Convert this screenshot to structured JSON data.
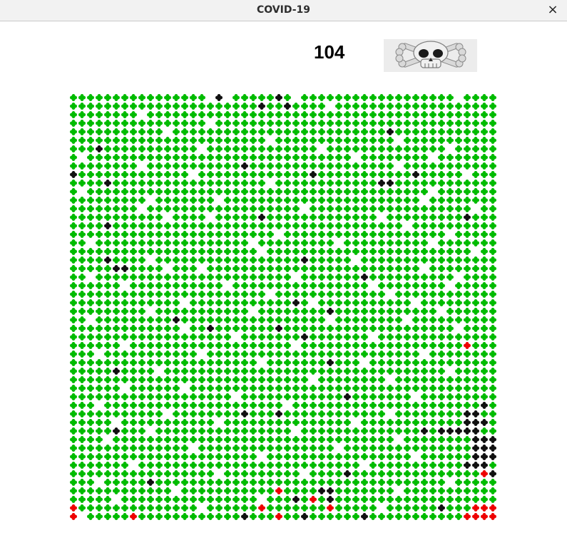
{
  "window": {
    "title": "COVID-19",
    "close_glyph": "×"
  },
  "header": {
    "count": "104",
    "skull_icon": "skull-and-crossbones-icon"
  },
  "grid": {
    "cols": 50,
    "rows": 50,
    "colors": {
      "healthy": "#00bb00",
      "infected": "#ee0000",
      "dead": "#111111",
      "empty": "#ffffff"
    },
    "dead": [
      [
        0,
        17
      ],
      [
        0,
        24
      ],
      [
        1,
        22
      ],
      [
        1,
        25
      ],
      [
        4,
        37
      ],
      [
        6,
        3
      ],
      [
        8,
        20
      ],
      [
        9,
        0
      ],
      [
        9,
        28
      ],
      [
        9,
        40
      ],
      [
        10,
        4
      ],
      [
        10,
        36
      ],
      [
        10,
        37
      ],
      [
        14,
        22
      ],
      [
        14,
        46
      ],
      [
        15,
        4
      ],
      [
        19,
        4
      ],
      [
        19,
        27
      ],
      [
        20,
        5
      ],
      [
        20,
        6
      ],
      [
        21,
        34
      ],
      [
        24,
        26
      ],
      [
        25,
        30
      ],
      [
        26,
        12
      ],
      [
        27,
        16
      ],
      [
        27,
        24
      ],
      [
        28,
        27
      ],
      [
        31,
        30
      ],
      [
        32,
        5
      ],
      [
        35,
        32
      ],
      [
        36,
        48
      ],
      [
        37,
        20
      ],
      [
        37,
        24
      ],
      [
        37,
        46
      ],
      [
        37,
        47
      ],
      [
        38,
        46
      ],
      [
        38,
        47
      ],
      [
        38,
        48
      ],
      [
        39,
        5
      ],
      [
        39,
        41
      ],
      [
        39,
        43
      ],
      [
        39,
        44
      ],
      [
        39,
        45
      ],
      [
        39,
        46
      ],
      [
        39,
        47
      ],
      [
        40,
        47
      ],
      [
        40,
        48
      ],
      [
        40,
        49
      ],
      [
        41,
        47
      ],
      [
        41,
        48
      ],
      [
        41,
        49
      ],
      [
        42,
        47
      ],
      [
        42,
        48
      ],
      [
        42,
        49
      ],
      [
        43,
        46
      ],
      [
        43,
        47
      ],
      [
        43,
        48
      ],
      [
        44,
        49
      ],
      [
        44,
        32
      ],
      [
        45,
        9
      ],
      [
        46,
        29
      ],
      [
        46,
        30
      ],
      [
        47,
        26
      ],
      [
        47,
        30
      ],
      [
        48,
        43
      ],
      [
        49,
        20
      ],
      [
        49,
        27
      ],
      [
        49,
        34
      ]
    ],
    "infected": [
      [
        29,
        46
      ],
      [
        44,
        48
      ],
      [
        46,
        24
      ],
      [
        47,
        28
      ],
      [
        48,
        49
      ],
      [
        48,
        48
      ],
      [
        49,
        46
      ],
      [
        49,
        47
      ],
      [
        49,
        48
      ],
      [
        49,
        49
      ],
      [
        48,
        47
      ],
      [
        48,
        0
      ],
      [
        49,
        0
      ],
      [
        49,
        7
      ],
      [
        49,
        24
      ],
      [
        48,
        22
      ],
      [
        48,
        30
      ]
    ],
    "empty": [
      [
        0,
        16
      ],
      [
        0,
        18
      ],
      [
        0,
        26
      ],
      [
        0,
        45
      ],
      [
        1,
        30
      ],
      [
        2,
        8
      ],
      [
        3,
        16
      ],
      [
        4,
        11
      ],
      [
        5,
        23
      ],
      [
        5,
        38
      ],
      [
        6,
        15
      ],
      [
        6,
        29
      ],
      [
        6,
        44
      ],
      [
        7,
        1
      ],
      [
        7,
        33
      ],
      [
        7,
        42
      ],
      [
        8,
        8
      ],
      [
        8,
        38
      ],
      [
        9,
        14
      ],
      [
        9,
        46
      ],
      [
        10,
        23
      ],
      [
        11,
        1
      ],
      [
        11,
        42
      ],
      [
        12,
        9
      ],
      [
        12,
        17
      ],
      [
        12,
        41
      ],
      [
        13,
        8
      ],
      [
        13,
        27
      ],
      [
        13,
        47
      ],
      [
        14,
        11
      ],
      [
        14,
        16
      ],
      [
        14,
        36
      ],
      [
        15,
        39
      ],
      [
        16,
        24
      ],
      [
        16,
        44
      ],
      [
        17,
        2
      ],
      [
        17,
        21
      ],
      [
        17,
        31
      ],
      [
        17,
        42
      ],
      [
        18,
        22
      ],
      [
        18,
        47
      ],
      [
        19,
        9
      ],
      [
        19,
        33
      ],
      [
        20,
        11
      ],
      [
        20,
        15
      ],
      [
        20,
        41
      ],
      [
        21,
        2
      ],
      [
        21,
        26
      ],
      [
        21,
        45
      ],
      [
        22,
        6
      ],
      [
        22,
        18
      ],
      [
        22,
        35
      ],
      [
        22,
        44
      ],
      [
        23,
        23
      ],
      [
        23,
        37
      ],
      [
        24,
        13
      ],
      [
        24,
        28
      ],
      [
        24,
        40
      ],
      [
        25,
        9
      ],
      [
        25,
        21
      ],
      [
        25,
        43
      ],
      [
        26,
        2
      ],
      [
        26,
        30
      ],
      [
        26,
        39
      ],
      [
        27,
        13
      ],
      [
        27,
        45
      ],
      [
        28,
        19
      ],
      [
        28,
        35
      ],
      [
        29,
        6
      ],
      [
        29,
        26
      ],
      [
        30,
        3
      ],
      [
        30,
        15
      ],
      [
        30,
        41
      ],
      [
        31,
        22
      ],
      [
        31,
        34
      ],
      [
        32,
        10
      ],
      [
        32,
        44
      ],
      [
        33,
        28
      ],
      [
        33,
        37
      ],
      [
        34,
        6
      ],
      [
        34,
        13
      ],
      [
        35,
        19
      ],
      [
        35,
        40
      ],
      [
        36,
        3
      ],
      [
        36,
        25
      ],
      [
        37,
        11
      ],
      [
        37,
        37
      ],
      [
        38,
        5
      ],
      [
        38,
        17
      ],
      [
        38,
        33
      ],
      [
        39,
        9
      ],
      [
        39,
        26
      ],
      [
        40,
        4
      ],
      [
        40,
        38
      ],
      [
        41,
        14
      ],
      [
        41,
        31
      ],
      [
        42,
        22
      ],
      [
        42,
        40
      ],
      [
        43,
        7
      ],
      [
        43,
        34
      ],
      [
        44,
        17
      ],
      [
        44,
        27
      ],
      [
        45,
        3
      ],
      [
        45,
        44
      ],
      [
        46,
        12
      ],
      [
        46,
        38
      ],
      [
        47,
        5
      ],
      [
        47,
        22
      ],
      [
        48,
        15
      ],
      [
        48,
        36
      ],
      [
        49,
        1
      ]
    ]
  }
}
